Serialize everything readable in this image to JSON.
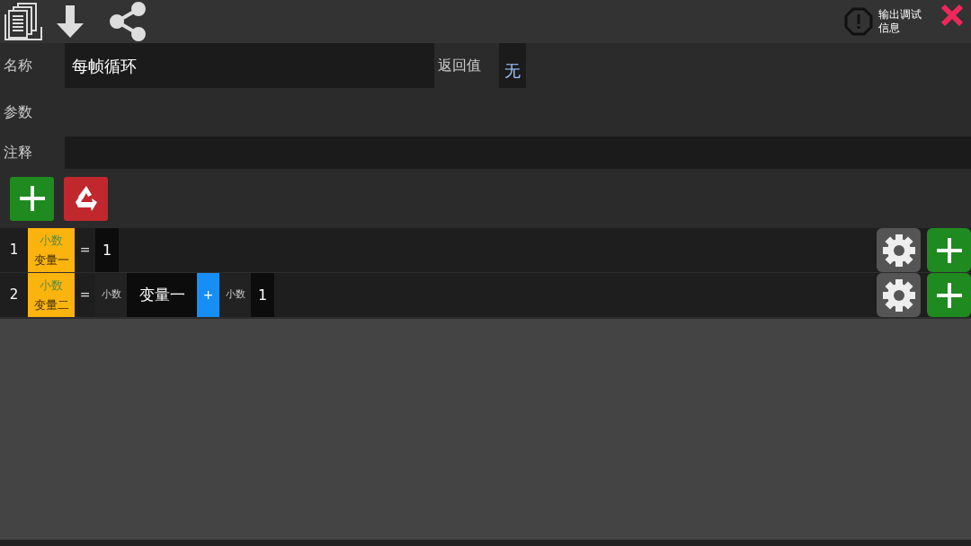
{
  "toolbar": {
    "debug_label": "输出调试信息"
  },
  "form": {
    "name_label": "名称",
    "name_value": "每帧循环",
    "return_label": "返回值",
    "return_value": "无",
    "params_label": "参数",
    "comment_label": "注释"
  },
  "lines": [
    {
      "number": "1",
      "tokens": [
        {
          "kind": "variable",
          "type": "小数",
          "name": "变量一"
        },
        {
          "kind": "symbol",
          "text": "="
        },
        {
          "kind": "value",
          "text": "1"
        }
      ]
    },
    {
      "number": "2",
      "tokens": [
        {
          "kind": "variable",
          "type": "小数",
          "name": "变量二"
        },
        {
          "kind": "symbol",
          "text": "="
        },
        {
          "kind": "type",
          "text": "小数"
        },
        {
          "kind": "reference",
          "text": "变量一"
        },
        {
          "kind": "operator",
          "text": "+"
        },
        {
          "kind": "type",
          "text": "小数"
        },
        {
          "kind": "value",
          "text": "1"
        }
      ]
    }
  ]
}
